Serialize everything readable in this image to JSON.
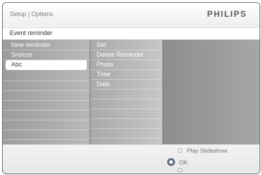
{
  "header": {
    "breadcrumb": "Setup | Options",
    "brand": "PHILIPS"
  },
  "menu_title": "Event reminder",
  "column1": {
    "items": [
      {
        "label": "New reminder"
      },
      {
        "label": "Snooze"
      },
      {
        "label": "Abc",
        "selected": true
      }
    ]
  },
  "column2": {
    "items": [
      {
        "label": "Set"
      },
      {
        "label": "Delete Reminder"
      },
      {
        "label": "Photo"
      },
      {
        "label": "Time"
      },
      {
        "label": "Date"
      }
    ]
  },
  "footer": {
    "play_hint": "Play Slideshow",
    "ok_hint": "OK"
  },
  "colors": {
    "selected_row": "#ffffff",
    "column_grey": "#a8a8a8"
  }
}
